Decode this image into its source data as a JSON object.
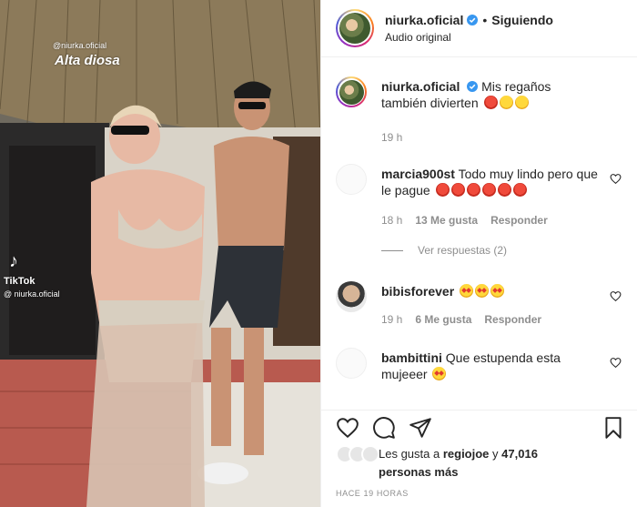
{
  "media": {
    "watermark_handle": "@niurka.oficial",
    "overlay_caption": "Alta diosa",
    "tiktok_logo": "♪",
    "tiktok_name": "TikTok",
    "tiktok_handle": "@ niurka.oficial"
  },
  "header": {
    "username": "niurka.oficial",
    "dot": "•",
    "follow_status": "Siguiendo",
    "audio": "Audio original"
  },
  "caption": {
    "username": "niurka.oficial",
    "text_before": "Mis regaños también divierten",
    "time": "19 h"
  },
  "comments": [
    {
      "username": "marcia900st",
      "text": "Todo muy lindo pero que le pague",
      "emoji_count": 6,
      "time": "18 h",
      "likes": "13 Me gusta",
      "reply": "Responder",
      "view_replies": "Ver respuestas (2)"
    },
    {
      "username": "bibisforever",
      "text": "",
      "emoji_count": 3,
      "time": "19 h",
      "likes": "6 Me gusta",
      "reply": "Responder"
    },
    {
      "username": "bambittini",
      "text": "Que estupenda esta mujeeer",
      "emoji_count": 1
    }
  ],
  "actions": {
    "icons": [
      "heart-icon",
      "comment-icon",
      "share-icon",
      "bookmark-icon"
    ],
    "likes_prefix": "Les gusta a",
    "likes_user": "regiojoe",
    "likes_mid": "y",
    "likes_count": "47,016 personas más",
    "timestamp": "HACE 19 HORAS"
  },
  "colors": {
    "verified": "#3897f0",
    "muted": "#8e8e8e",
    "text": "#262626"
  }
}
